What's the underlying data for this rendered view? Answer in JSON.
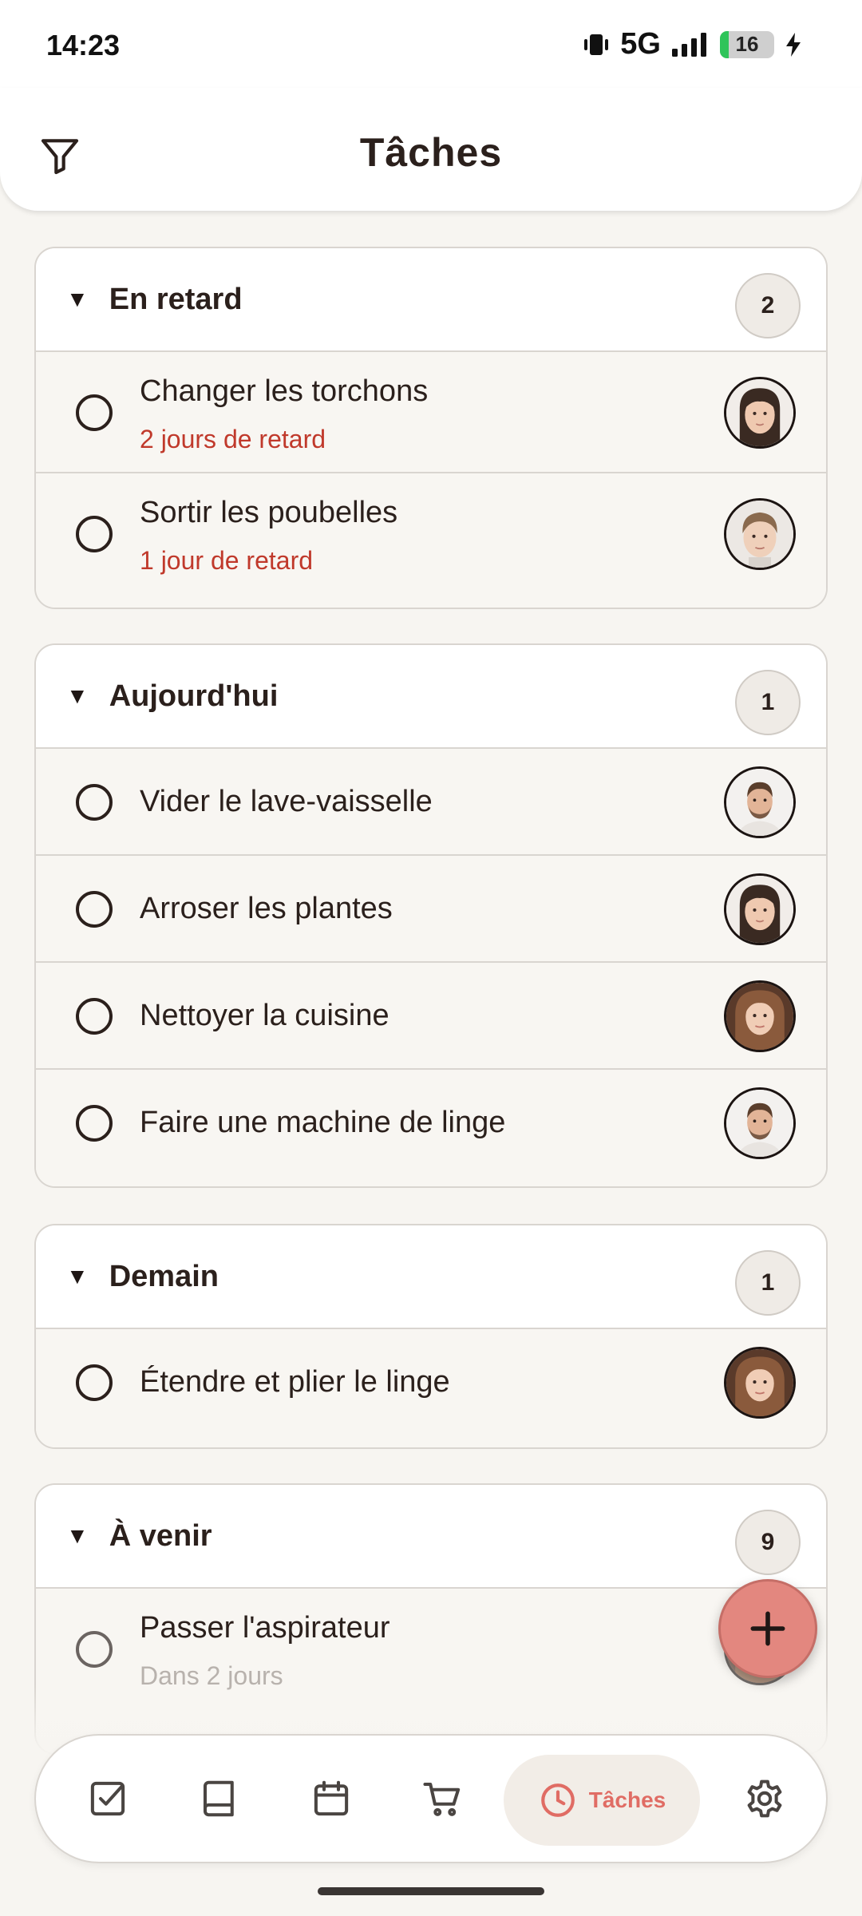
{
  "status_bar": {
    "time": "14:23",
    "network": "5G",
    "battery_level": "16",
    "battery_fraction": 0.16
  },
  "header": {
    "title": "Tâches",
    "filter_icon": "filter-icon"
  },
  "sections": [
    {
      "title": "En retard",
      "count": "2",
      "tasks": [
        {
          "title": "Changer les torchons",
          "subtitle": "2 jours de retard",
          "subtitle_style": "late",
          "avatar": "girl"
        },
        {
          "title": "Sortir les poubelles",
          "subtitle": "1 jour de retard",
          "subtitle_style": "late",
          "avatar": "boy"
        }
      ]
    },
    {
      "title": "Aujourd'hui",
      "count": "1",
      "tasks": [
        {
          "title": "Vider le lave-vaisselle",
          "avatar": "man"
        },
        {
          "title": "Arroser les plantes",
          "avatar": "girl"
        },
        {
          "title": "Nettoyer la cuisine",
          "avatar": "woman"
        },
        {
          "title": "Faire une machine de linge",
          "avatar": "man"
        }
      ]
    },
    {
      "title": "Demain",
      "count": "1",
      "tasks": [
        {
          "title": "Étendre et plier le linge",
          "avatar": "woman"
        }
      ]
    },
    {
      "title": "À venir",
      "count": "9",
      "tasks": [
        {
          "title": "Passer l'aspirateur",
          "subtitle": "Dans 2 jours",
          "subtitle_style": "muted",
          "avatar": "woman"
        }
      ]
    }
  ],
  "fab": {
    "icon": "plus-icon"
  },
  "bottom_nav": {
    "items": [
      {
        "icon": "checkbox-icon"
      },
      {
        "icon": "book-icon"
      },
      {
        "icon": "calendar-icon"
      },
      {
        "icon": "cart-icon"
      },
      {
        "icon": "clock-icon",
        "label": "Tâches",
        "active": true
      },
      {
        "icon": "gear-icon"
      }
    ]
  },
  "colors": {
    "accent": "#e06c64",
    "late": "#c0392b",
    "background": "#f7f5f1",
    "text": "#2b201c"
  }
}
